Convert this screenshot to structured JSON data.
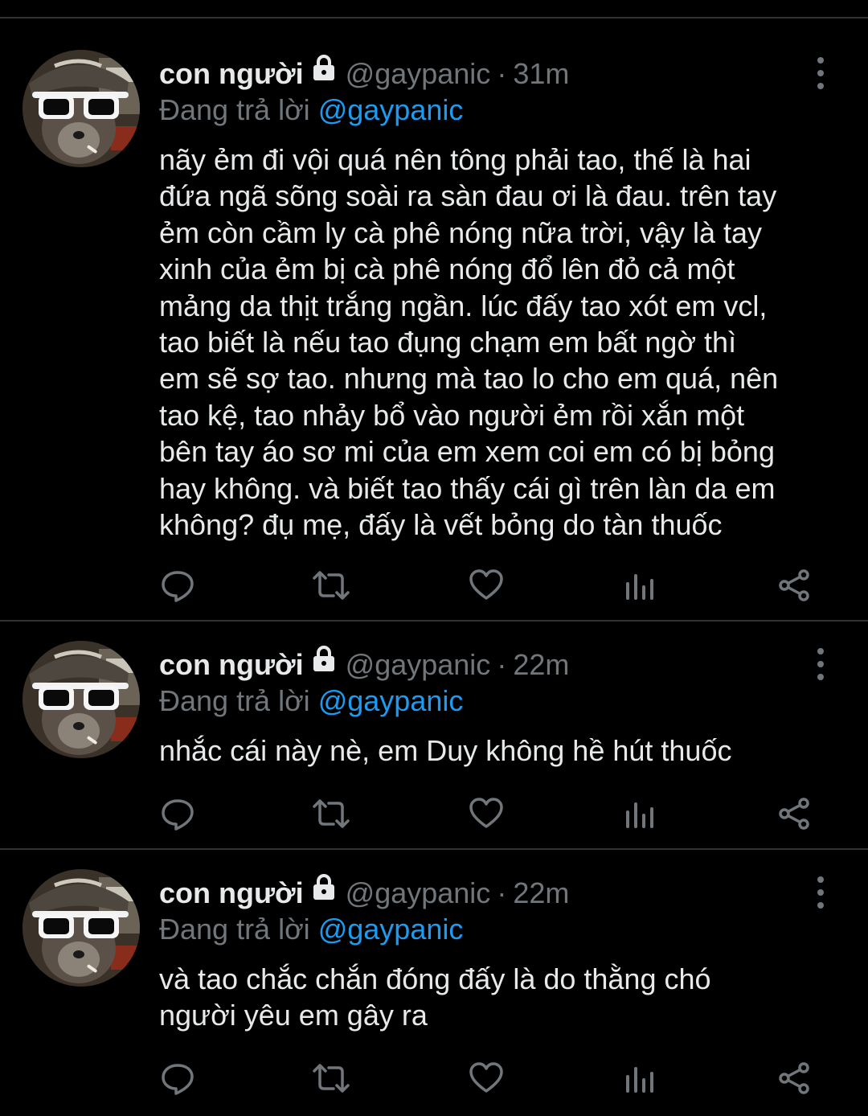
{
  "colors": {
    "background": "#000000",
    "text": "#e7e9ea",
    "muted": "#71767b",
    "link": "#1d9bf0",
    "divider": "#2f3336"
  },
  "tweets": [
    {
      "display_name": "con người",
      "handle": "@gaypanic",
      "separator": "·",
      "time": "31m",
      "reply_prefix": "Đang trả lời",
      "reply_to": "@gaypanic",
      "text": "nãy ẻm đi vội quá nên tông phải tao, thế là hai\nđứa ngã sõng soài ra sàn đau ơi là đau. trên tay\nẻm còn cầm ly cà phê nóng nữa trời, vậy là tay\nxinh của ẻm bị cà phê nóng đổ lên đỏ cả một\nmảng da thịt trắng ngần. lúc đấy tao xót em vcl,\ntao biết là nếu tao đụng chạm em bất ngờ thì\nem sẽ sợ tao. nhưng mà tao lo cho em quá, nên\ntao kệ, tao nhảy bổ vào người ẻm rồi xắn một\nbên tay áo sơ mi của em xem coi em có bị bỏng\nhay không. và biết tao thấy cái gì trên làn da em\nkhông? đụ mẹ, đấy là vết bỏng do tàn thuốc"
    },
    {
      "display_name": "con người",
      "handle": "@gaypanic",
      "separator": "·",
      "time": "22m",
      "reply_prefix": "Đang trả lời",
      "reply_to": "@gaypanic",
      "text": "nhắc cái này nè, em Duy không hề hút thuốc"
    },
    {
      "display_name": "con người",
      "handle": "@gaypanic",
      "separator": "·",
      "time": "22m",
      "reply_prefix": "Đang trả lời",
      "reply_to": "@gaypanic",
      "text": "và tao chắc chắn đóng đấy là do thằng chó\nngười yêu em gây ra"
    }
  ],
  "icons": {
    "lock": "lock-icon",
    "more": "more-vertical-icon",
    "reply": "reply-icon",
    "retweet": "retweet-icon",
    "like": "heart-icon",
    "views": "analytics-icon",
    "share": "share-icon"
  }
}
